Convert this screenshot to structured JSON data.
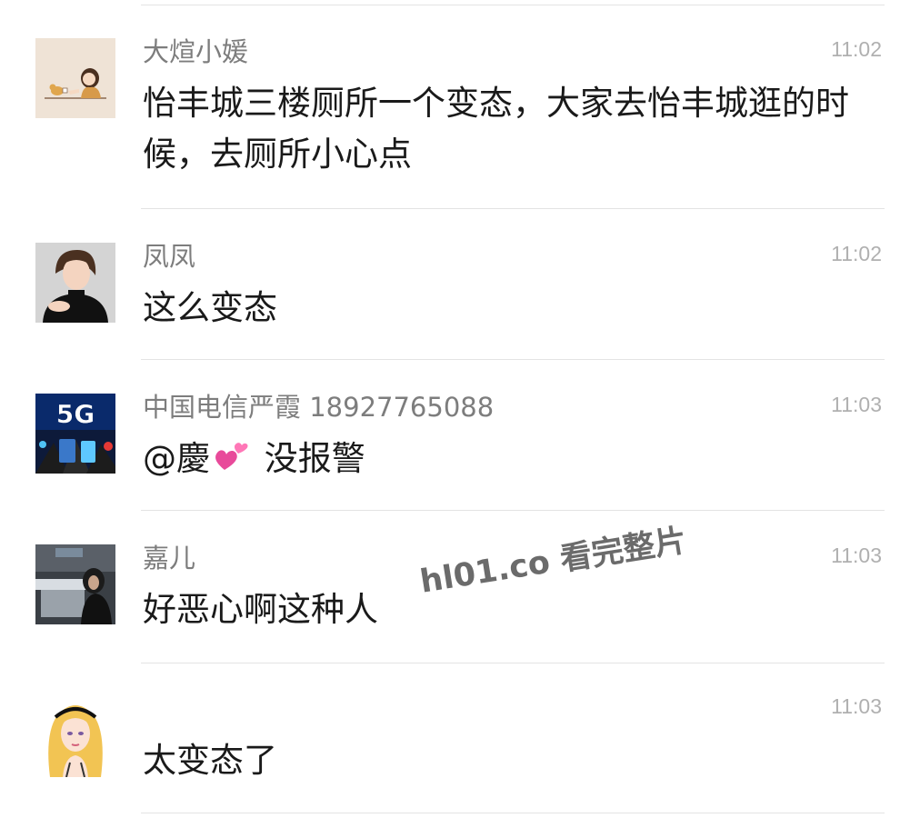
{
  "comments": [
    {
      "author": "大煊小媛",
      "time": "11:02",
      "message": "怡丰城三楼厕所一个变态，大家去怡丰城逛的时候，去厕所小心点",
      "avatar_icon": "girl-with-cat-cartoon-avatar"
    },
    {
      "author": "凤凤",
      "time": "11:02",
      "message": "这么变态",
      "avatar_icon": "woman-portrait-avatar"
    },
    {
      "author": "中国电信严霞 18927765088",
      "time": "11:03",
      "message_mention": "@慶",
      "message_emoji": "two-hearts-emoji",
      "message_text": "没报警",
      "avatar_icon": "5g-telecom-avatar",
      "avatar_label": "5G"
    },
    {
      "author": "嘉儿",
      "time": "11:03",
      "message": "好恶心啊这种人",
      "avatar_icon": "woman-in-room-photo-avatar"
    },
    {
      "author": "",
      "time": "11:03",
      "message": "太变态了",
      "avatar_icon": "blonde-girl-illustration-avatar"
    }
  ],
  "watermark": "hl01.co 看完整片",
  "colors": {
    "name": "#7d7d7d",
    "time": "#b0b0b0",
    "message": "#1a1a1a",
    "divider": "#e3e3e3"
  }
}
